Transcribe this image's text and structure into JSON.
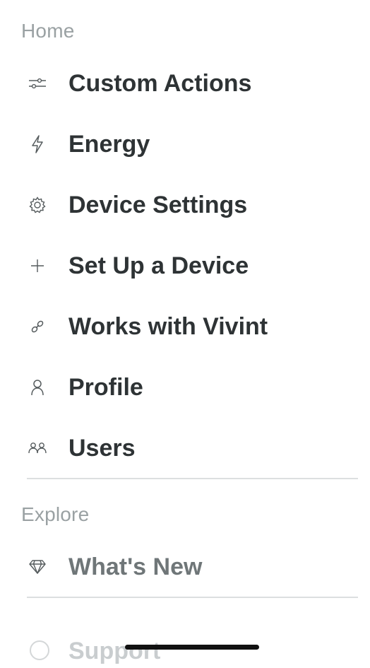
{
  "home": {
    "header": "Home",
    "items": [
      {
        "label": "Custom Actions",
        "icon": "sliders-icon"
      },
      {
        "label": "Energy",
        "icon": "lightning-icon"
      },
      {
        "label": "Device Settings",
        "icon": "gear-icon"
      },
      {
        "label": "Set Up a Device",
        "icon": "plus-icon"
      },
      {
        "label": "Works with Vivint",
        "icon": "link-icon"
      },
      {
        "label": "Profile",
        "icon": "person-icon"
      },
      {
        "label": "Users",
        "icon": "people-icon"
      }
    ]
  },
  "explore": {
    "header": "Explore",
    "items": [
      {
        "label": "What's New",
        "icon": "diamond-icon"
      },
      {
        "label": "Support",
        "icon": "help-circle-icon"
      }
    ]
  },
  "colors": {
    "text_primary": "#2e3335",
    "text_header": "#9aa1a3",
    "divider": "#dcdfe0",
    "background": "#ffffff"
  }
}
